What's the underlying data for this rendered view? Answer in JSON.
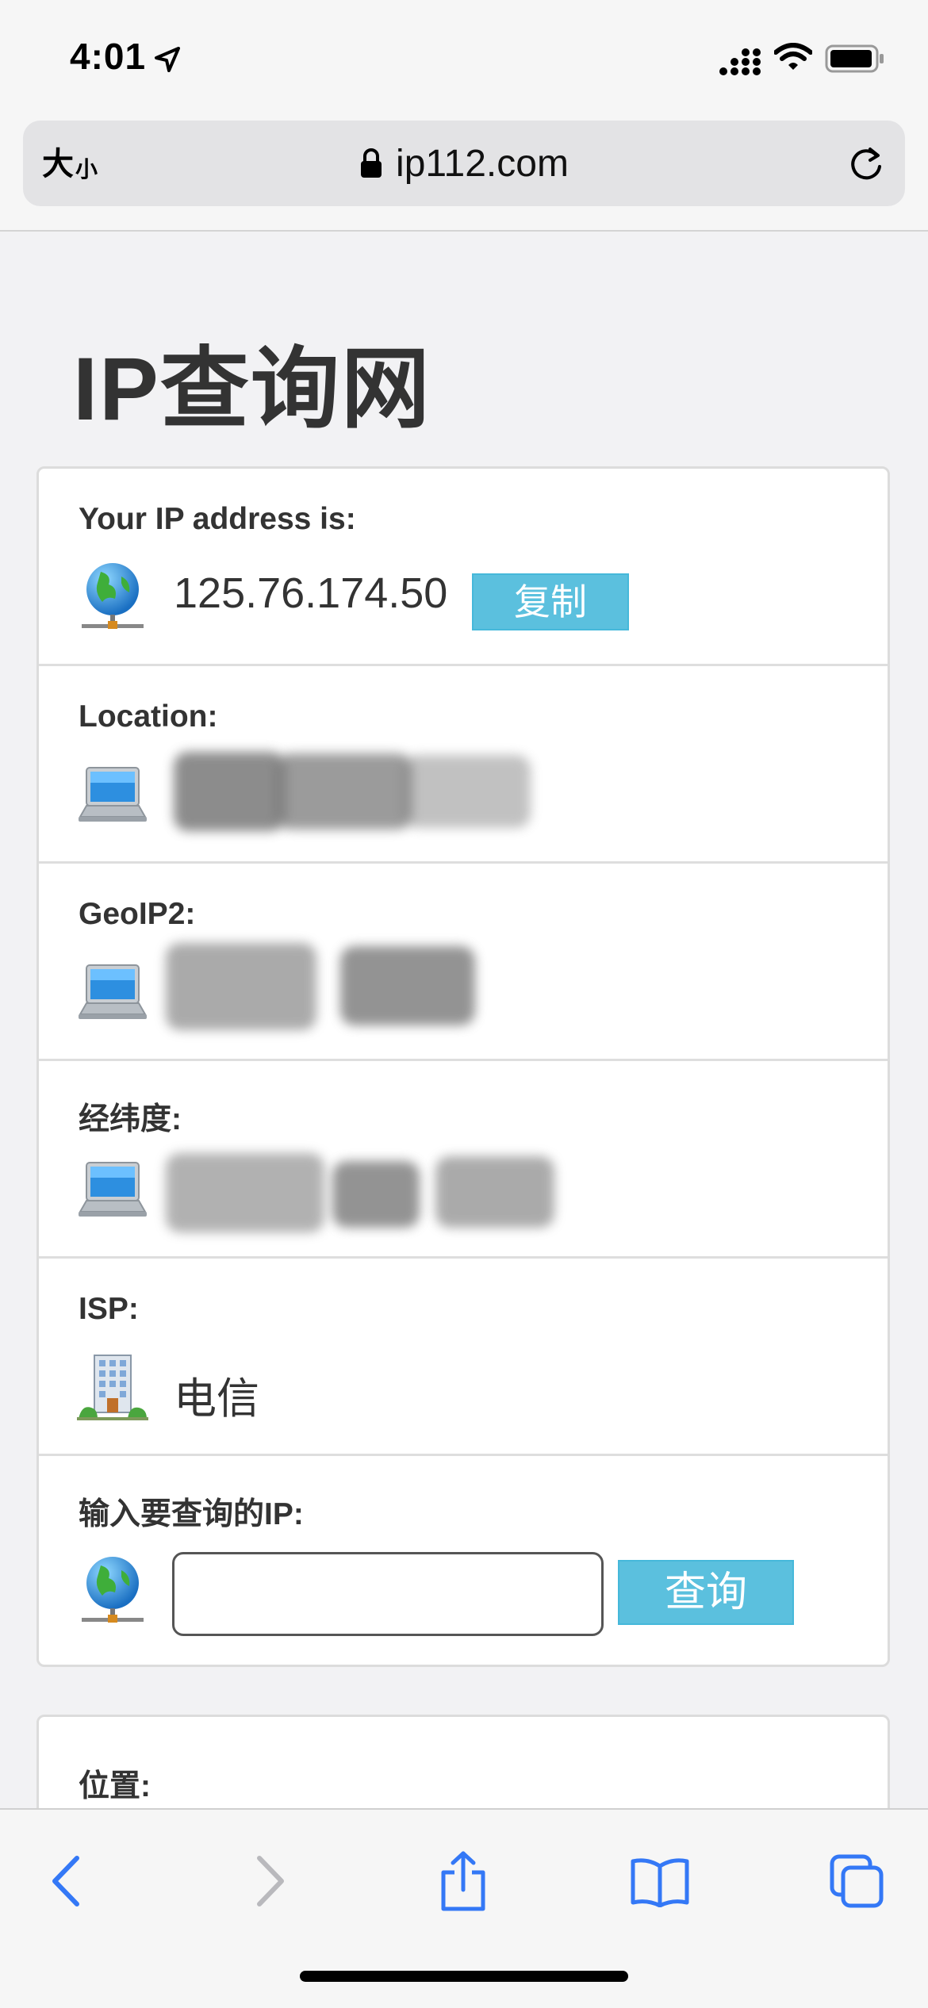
{
  "status_bar": {
    "time": "4:01",
    "icons": [
      "location-arrow-icon",
      "cellular-signal-icon",
      "wifi-icon",
      "battery-icon"
    ]
  },
  "address_bar": {
    "text_size_big": "大",
    "text_size_small": "小",
    "url": "ip112.com",
    "icons": [
      "lock-icon",
      "reload-icon"
    ]
  },
  "page": {
    "title": "IP查询网"
  },
  "ip_card": {
    "your_ip": {
      "label": "Your IP address is:",
      "value": "125.76.174.50",
      "copy_button": "复制",
      "icon": "globe-network-icon"
    },
    "location": {
      "label": "Location:",
      "icon": "laptop-icon",
      "redacted": true
    },
    "geoip2": {
      "label": "GeoIP2:",
      "icon": "laptop-icon",
      "redacted": true
    },
    "latlng": {
      "label": "经纬度:",
      "icon": "laptop-icon",
      "redacted": true
    },
    "isp": {
      "label": "ISP:",
      "value": "电信",
      "icon": "building-icon"
    },
    "query": {
      "label": "输入要查询的IP:",
      "input_value": "",
      "input_placeholder": "",
      "button": "查询",
      "icon": "globe-network-icon"
    }
  },
  "position_card": {
    "label": "位置:"
  },
  "toolbar": {
    "buttons": [
      "back-icon",
      "forward-icon",
      "share-icon",
      "bookmarks-icon",
      "tabs-icon"
    ],
    "accent_color": "#3478f6",
    "disabled_color": "#b9b9bd"
  },
  "colors": {
    "button_bg": "#5bc0de",
    "page_bg": "#f2f2f4",
    "card_bg": "#ffffff"
  }
}
